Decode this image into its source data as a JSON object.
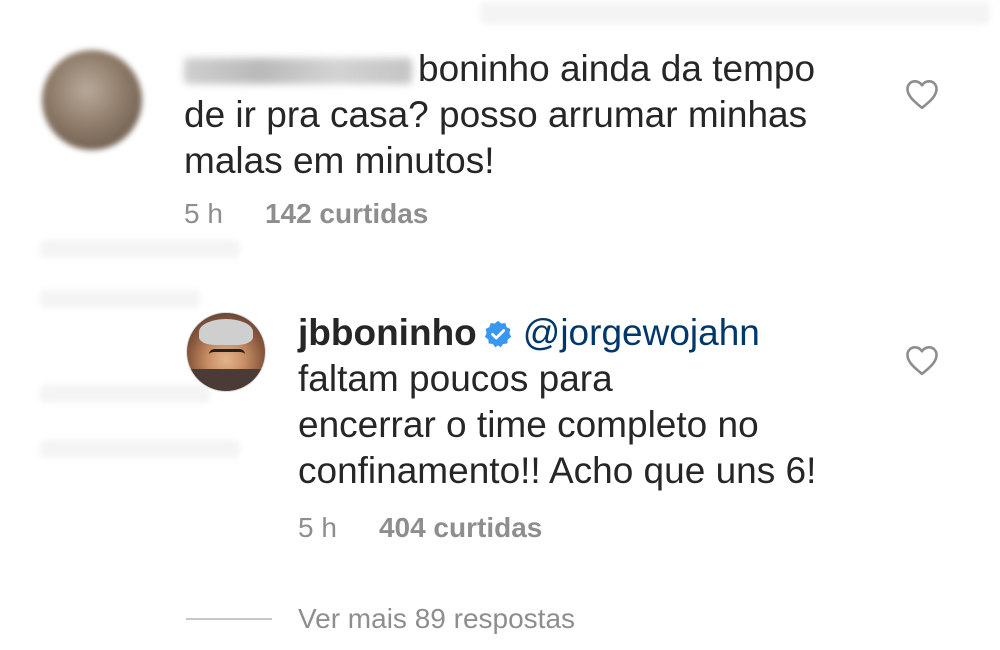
{
  "comment1": {
    "username_visible": false,
    "text_line1": "boninho ainda da tempo",
    "text_line2": "de ir pra casa? posso arrumar minhas",
    "text_line3": "malas em minutos!",
    "time": "5 h",
    "likes": "142 curtidas",
    "like_icon": "heart-outline-icon"
  },
  "reply1": {
    "username": "jbboninho",
    "verified_icon": "verified-badge-icon",
    "mention": "@jorgewojahn",
    "text_line1": "faltam poucos para",
    "text_line2": "encerrar o time completo no",
    "text_line3": "confinamento!! Acho que uns 6!",
    "time": "5 h",
    "likes": "404 curtidas",
    "like_icon": "heart-outline-icon"
  },
  "replies_link": "Ver mais 89 respostas",
  "colors": {
    "text": "#262626",
    "muted": "#8e8e8e",
    "mention": "#00376b",
    "verified": "#3897f0"
  }
}
